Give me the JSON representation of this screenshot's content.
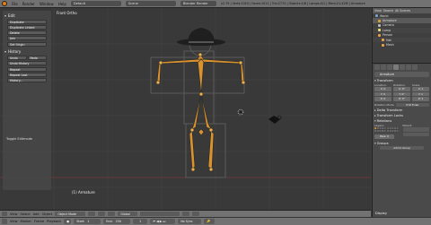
{
  "topbar": {
    "menus": [
      "File",
      "Render",
      "Window",
      "Help"
    ],
    "layout": "Default",
    "scene": "Scene",
    "engine": "Blender Render",
    "stats": "v2.79 | Verts:1010 | Faces:1011 | Tris:2770 | Objects:1/8 | Lamps:0/1 | Mem:21.42M | Armature"
  },
  "viewport": {
    "view_label": "Front Ortho",
    "object_label": "(1) Armature"
  },
  "toolshelf": {
    "edit_header": "Edit",
    "edit_buttons": [
      "Duplicate",
      "Duplicate Linked",
      "Delete",
      "Join"
    ],
    "set_origin": "Set Origin",
    "history_header": "History",
    "undo": "Undo",
    "redo": "Redo",
    "undo_history": "Undo History",
    "repeat_buttons": [
      "Repeat",
      "Repeat Last",
      "History..."
    ],
    "toggle_label": "Toggle Editmode"
  },
  "outliner": {
    "menus": [
      "View",
      "Search",
      "All Scenes"
    ],
    "rows": [
      "World",
      "Armature",
      "Camera",
      "Lamp",
      "Person",
      "Hat",
      "Mesh"
    ]
  },
  "properties": {
    "object_name": "Armature",
    "transform_header": "Transform",
    "col_headers": [
      "Location:",
      "Rotation:",
      "Scale:"
    ],
    "location": [
      "X: 0",
      "Y: 0",
      "Z: 0"
    ],
    "rotation": [
      "X: 0°",
      "Y: 0°",
      "Z: 0°"
    ],
    "scale": [
      "X: 1",
      "Y: 1",
      "Z: 1"
    ],
    "rotation_mode_label": "Rotation Mode",
    "rotation_mode": "XYZ Euler",
    "panels_closed": [
      "Delta Transform",
      "Transform Locks"
    ],
    "relations_header": "Relations",
    "layers_label": "Layers:",
    "parent_label": "Parent:",
    "pass_index": "Pass: 0",
    "groups_header": "Groups",
    "add_to_group": "Add to Group",
    "display_header": "Display"
  },
  "vp_header": {
    "menus": [
      "View",
      "Select",
      "Add",
      "Object"
    ],
    "mode": "Object Mode",
    "pivot": "Global"
  },
  "timeline": {
    "menus": [
      "View",
      "Marker",
      "Frame",
      "Playback"
    ],
    "start": "Start:",
    "start_val": "1",
    "end": "End:",
    "end_val": "250",
    "current": "1",
    "sync": "No Sync"
  },
  "colors": {
    "bone": "#d9922e",
    "bone_outline": "#2a2a2a",
    "hat": "#1f1f1f",
    "body_outline": "#5a5a5a",
    "accent": "#e87d0d"
  }
}
